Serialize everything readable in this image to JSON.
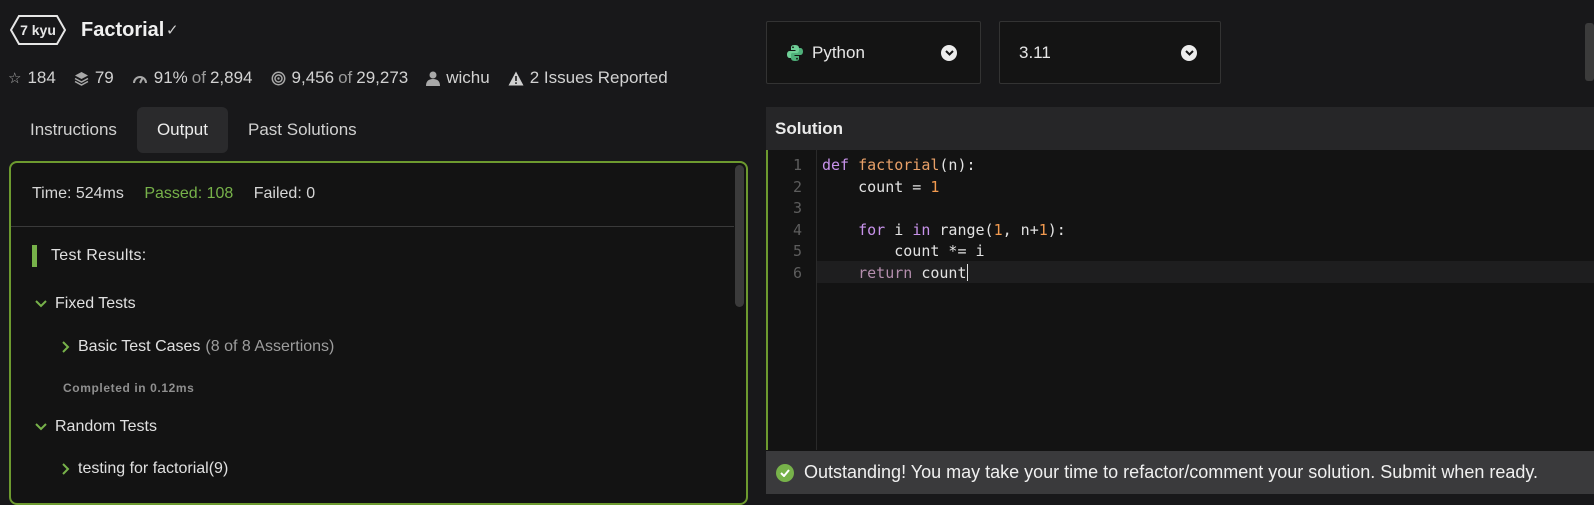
{
  "kata": {
    "rank": "7 kyu",
    "title": "Factorial"
  },
  "stats": {
    "stars": "184",
    "collections": "79",
    "satisfaction_pct": "91%",
    "satisfaction_of": "of",
    "satisfaction_votes": "2,894",
    "completed": "9,456",
    "completed_of": "of",
    "attempted": "29,273",
    "author": "wichu",
    "issues": "2 Issues Reported"
  },
  "tabs": [
    "Instructions",
    "Output",
    "Past Solutions"
  ],
  "active_tab": "Output",
  "output": {
    "time": "Time: 524ms",
    "passed": "Passed: 108",
    "failed": "Failed: 0",
    "results_title": "Test Results:",
    "groups": [
      {
        "label": "Fixed Tests"
      },
      {
        "label": "Random Tests"
      }
    ],
    "basic_case": "Basic Test Cases",
    "basic_assertions": "(8 of 8 Assertions)",
    "completed_in": "Completed in 0.12ms",
    "random_case": "testing for factorial(9)"
  },
  "language_select": {
    "value": "Python",
    "icon": "python-icon"
  },
  "version_select": {
    "value": "3.11"
  },
  "editor": {
    "title": "Solution",
    "line_numbers": [
      "1",
      "2",
      "3",
      "4",
      "5",
      "6"
    ],
    "code": {
      "l1_kw": "def",
      "l1_fn": "factorial",
      "l1_rest": "(n):",
      "l2_a": "    count = ",
      "l2_num": "1",
      "l4_kw1": "for",
      "l4_mid": " i ",
      "l4_kw2": "in",
      "l4_fn": " range(",
      "l4_num1": "1",
      "l4_mid2": ", n+",
      "l4_num2": "1",
      "l4_end": "):",
      "l5": "        count *= i",
      "l6_kw": "return",
      "l6_rest": " count"
    }
  },
  "banner": {
    "message": "Outstanding! You may take your time to refactor/comment your solution. Submit when ready."
  },
  "colors": {
    "accent_green": "#77b24a",
    "panel_border": "#6d9a2f",
    "background": "#18181a"
  }
}
